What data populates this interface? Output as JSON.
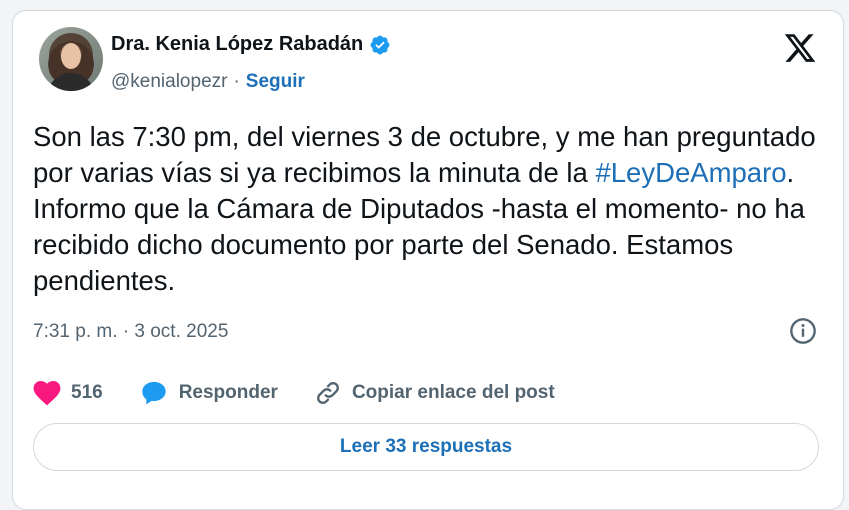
{
  "author": {
    "name": "Dra. Kenia López Rabadán",
    "handle": "@kenialopezr",
    "separator": "·",
    "follow_label": "Seguir"
  },
  "post": {
    "text_before": "Son las 7:30 pm, del viernes 3 de octubre, y me han preguntado por varias vías si ya recibimos la minuta de la ",
    "hashtag": "#LeyDeAmparo",
    "text_after": ". Informo que la Cámara de Diputados -hasta el momento- no ha recibido dicho documento por parte del Senado. Estamos pendientes.",
    "timestamp": "7:31 p. m. · 3 oct. 2025"
  },
  "actions": {
    "likes_count": "516",
    "reply_label": "Responder",
    "copy_label": "Copiar enlace del post"
  },
  "read_replies_label": "Leer 33 respuestas",
  "icons": {
    "verified": "verified-badge-icon",
    "logo": "x-logo-icon",
    "info": "info-icon",
    "like": "heart-icon",
    "reply": "speech-bubble-icon",
    "link": "link-icon"
  },
  "colors": {
    "accent": "#1d6fb8",
    "verified": "#1d9bf0",
    "heart": "#f91880",
    "text": "#0f1419",
    "muted": "#536471"
  }
}
